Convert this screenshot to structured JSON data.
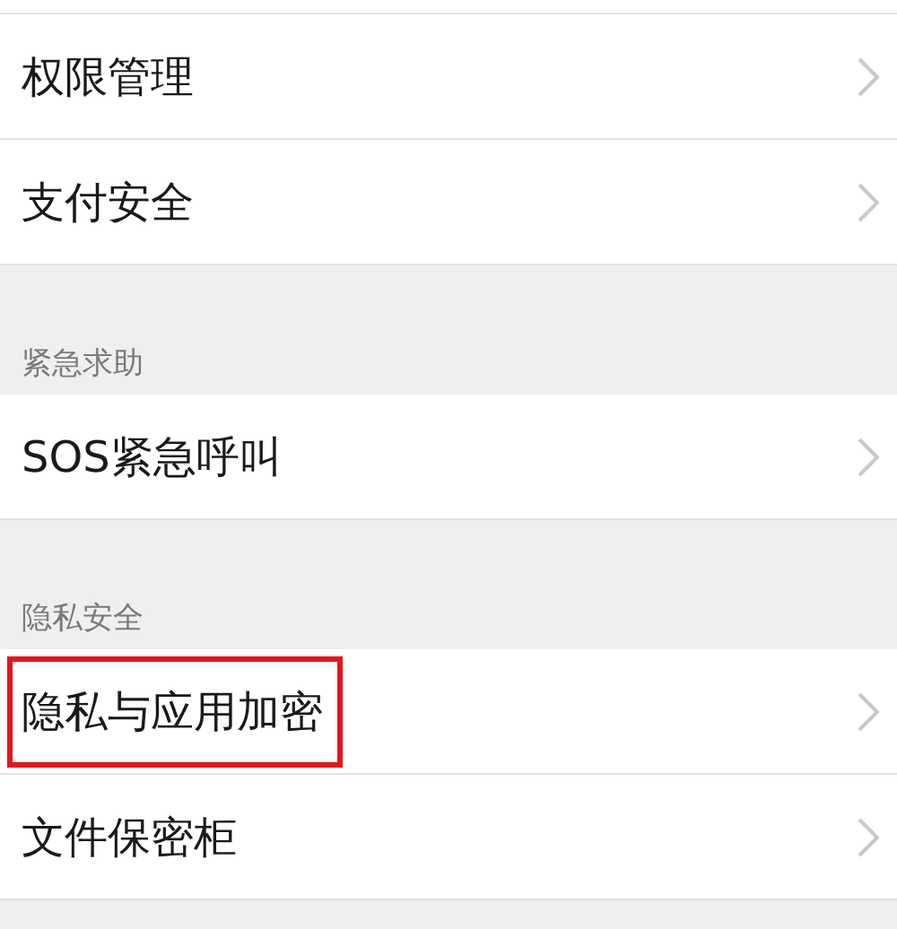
{
  "sections": [
    {
      "items": [
        {
          "label": "权限管理",
          "highlighted": false
        },
        {
          "label": "支付安全",
          "highlighted": false
        }
      ]
    },
    {
      "header": "紧急求助",
      "items": [
        {
          "label": "SOS紧急呼叫",
          "highlighted": false
        }
      ]
    },
    {
      "header": "隐私安全",
      "items": [
        {
          "label": "隐私与应用加密",
          "highlighted": true
        },
        {
          "label": "文件保密柜",
          "highlighted": false
        }
      ]
    }
  ]
}
